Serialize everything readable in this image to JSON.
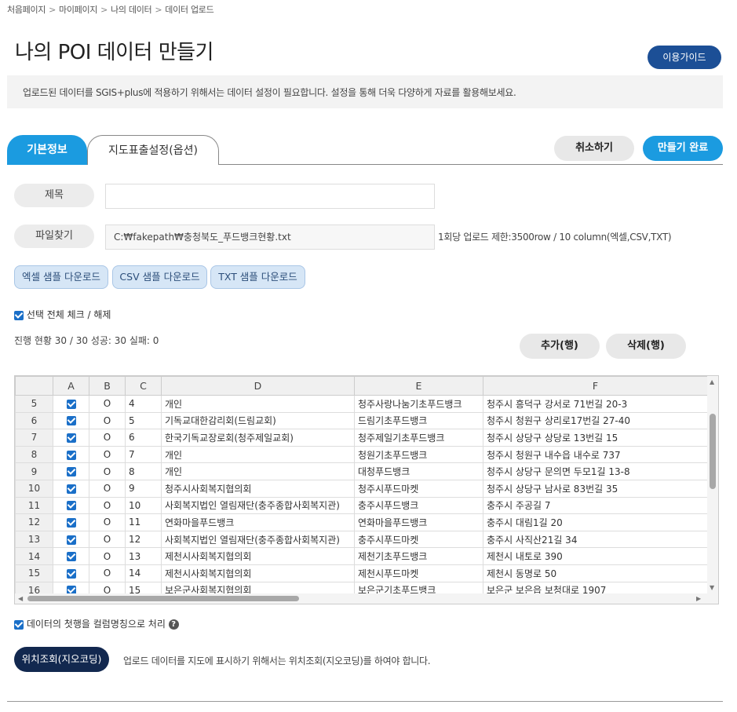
{
  "breadcrumb": [
    "처음페이지",
    "마이페이지",
    "나의 데이터",
    "데이터 업로드"
  ],
  "page_title": "나의 POI 데이터 만들기",
  "guide_button": "이용가이드",
  "notice": "업로드된 데이터를 SGIS+plus에 적용하기 위해서는 데이터 설정이 필요합니다. 설정을 통해 더욱 다양하게 자료를 활용해보세요.",
  "tabs": [
    {
      "label": "기본정보",
      "active": true
    },
    {
      "label": "지도표출설정(옵션)",
      "active": false
    }
  ],
  "actions": {
    "cancel": "취소하기",
    "done": "만들기 완료"
  },
  "form": {
    "title_label": "제목",
    "title_value": "",
    "file_label": "파일찾기",
    "file_value": "C:₩fakepath₩충청북도_푸드뱅크현황.txt",
    "upload_limit": "1회당 업로드 제한:3500row / 10 column(엑셀,CSV,TXT)"
  },
  "sample_buttons": [
    "엑셀 샘플 다운로드",
    "CSV 샘플 다운로드",
    "TXT 샘플 다운로드"
  ],
  "select_all": "선택 전체 체크 / 해제",
  "progress": "진행 현황 30 /  30 성공: 30 실패: 0",
  "row_buttons": {
    "add": "추가(행)",
    "delete": "삭제(행)"
  },
  "grid": {
    "columns": [
      "",
      "A",
      "B",
      "C",
      "D",
      "E",
      "F"
    ],
    "rows": [
      {
        "n": "5",
        "b": "O",
        "c": "4",
        "d": "개인",
        "e": "청주사랑나눔기초푸드뱅크",
        "f": "청주시 흥덕구 강서로 71번길 20-3"
      },
      {
        "n": "6",
        "b": "O",
        "c": "5",
        "d": "기독교대한감리회(드림교회)",
        "e": "드림기초푸드뱅크",
        "f": "청주시 청원구 상리로17번길 27-40"
      },
      {
        "n": "7",
        "b": "O",
        "c": "6",
        "d": "한국기독교장로회(청주제일교회)",
        "e": "청주제일기초푸드뱅크",
        "f": "청주시 상당구 상당로 13번길 15"
      },
      {
        "n": "8",
        "b": "O",
        "c": "7",
        "d": "개인",
        "e": "청원기초푸드뱅크",
        "f": "청주시 청원구 내수읍 내수로 737"
      },
      {
        "n": "9",
        "b": "O",
        "c": "8",
        "d": "개인",
        "e": "대청푸드뱅크",
        "f": "청주시 상당구 문의면 두모1길 13-8"
      },
      {
        "n": "10",
        "b": "O",
        "c": "9",
        "d": "청주시사회복지협의회",
        "e": "청주시푸드마켓",
        "f": "청주시 상당구 남사로 83번길 35"
      },
      {
        "n": "11",
        "b": "O",
        "c": "10",
        "d": "사회복지법인 열림재단(충주종합사회복지관)",
        "e": "충주시푸드뱅크",
        "f": "충주시 주공길 7"
      },
      {
        "n": "12",
        "b": "O",
        "c": "11",
        "d": "연화마을푸드뱅크",
        "e": "연화마을푸드뱅크",
        "f": "충주시 대림1길 20"
      },
      {
        "n": "13",
        "b": "O",
        "c": "12",
        "d": "사회복지법인 열림재단(충주종합사회복지관)",
        "e": "충주시푸드마켓",
        "f": "충주시 사직산21길 34"
      },
      {
        "n": "14",
        "b": "O",
        "c": "13",
        "d": "제천시사회복지협의회",
        "e": "제천기초푸드뱅크",
        "f": "제천시 내토로 390"
      },
      {
        "n": "15",
        "b": "O",
        "c": "14",
        "d": "제천시사회복지협의회",
        "e": "제천시푸드마켓",
        "f": "제천시 동명로 50"
      },
      {
        "n": "16",
        "b": "O",
        "c": "15",
        "d": "보은군사회복지협의회",
        "e": "보은군기초푸드뱅크",
        "f": "보은군 보은읍 보청대로 1907"
      }
    ]
  },
  "header_as_column": "데이터의 첫행을 컬럼명칭으로 처리",
  "help_icon": "?",
  "geocode_button": "위치조회(지오코딩)",
  "geocode_text": "업로드 데이터를 지도에 표시하기 위해서는 위치조회(지오코딩)를 하여야 합니다.",
  "colors": {
    "primary": "#1b9be0",
    "navy": "#1c4f96",
    "dark_navy": "#12284f",
    "checkbox": "#1a6fc8"
  }
}
